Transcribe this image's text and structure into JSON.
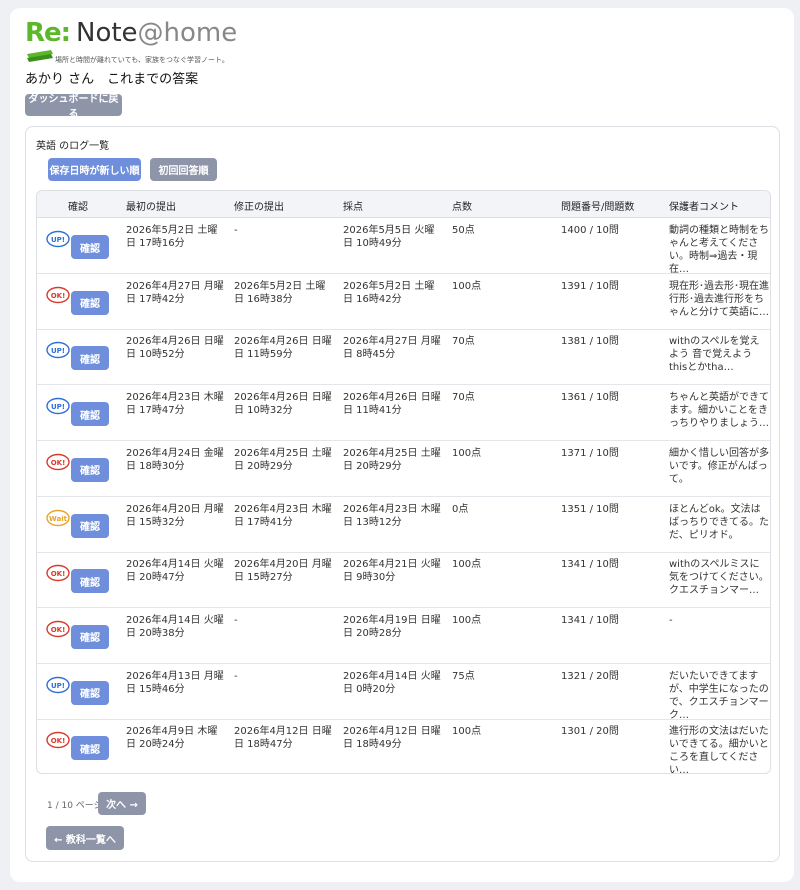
{
  "logo": {
    "re": "Re:",
    "note": "Note",
    "at": "@",
    "home": "home",
    "tagline": "場所と時間が離れていても、家族をつなぐ学習ノート。"
  },
  "page_title": "あかり さん　これまでの答案",
  "back_button": "ダッシュボードに戻る",
  "log_title": "英語 のログ一覧",
  "sort": {
    "newest": "保存日時が新しい順",
    "first": "初回回答順"
  },
  "table": {
    "headers": [
      "確認",
      "最初の提出",
      "修正の提出",
      "採点",
      "点数",
      "問題番号/問題数",
      "保護者コメント"
    ],
    "confirm_label": "確認",
    "rows": [
      {
        "stamp": "up",
        "stamp_text": "UP!",
        "first": "2026年5月2日 土曜日 17時16分",
        "fix": "-",
        "score": "2026年5月5日 火曜日 10時49分",
        "points": "50点",
        "num": "1400 / 10問",
        "comment": "動詞の種類と時制をちゃんと考えてください。時制⇒過去・現在…"
      },
      {
        "stamp": "ok",
        "stamp_text": "OK!",
        "first": "2026年4月27日 月曜日 17時42分",
        "fix": "2026年5月2日 土曜日 16時38分",
        "score": "2026年5月2日 土曜日 16時42分",
        "points": "100点",
        "num": "1391 / 10問",
        "comment": "現在形･過去形･現在進行形･過去進行形をちゃんと分けて英語に…"
      },
      {
        "stamp": "up",
        "stamp_text": "UP!",
        "first": "2026年4月26日 日曜日 10時52分",
        "fix": "2026年4月26日 日曜日 11時59分",
        "score": "2026年4月27日 月曜日 8時45分",
        "points": "70点",
        "num": "1381 / 10問",
        "comment": "withのスペルを覚えよう 音で覚えよう thisとかtha…"
      },
      {
        "stamp": "up",
        "stamp_text": "UP!",
        "first": "2026年4月23日 木曜日 17時47分",
        "fix": "2026年4月26日 日曜日 10時32分",
        "score": "2026年4月26日 日曜日 11時41分",
        "points": "70点",
        "num": "1361 / 10問",
        "comment": "ちゃんと英語ができてます。細かいことをきっちりやりましょう…"
      },
      {
        "stamp": "ok",
        "stamp_text": "OK!",
        "first": "2026年4月24日 金曜日 18時30分",
        "fix": "2026年4月25日 土曜日 20時29分",
        "score": "2026年4月25日 土曜日 20時29分",
        "points": "100点",
        "num": "1371 / 10問",
        "comment": "細かく惜しい回答が多いです。修正がんばって。"
      },
      {
        "stamp": "wait",
        "stamp_text": "Wait",
        "first": "2026年4月20日 月曜日 15時32分",
        "fix": "2026年4月23日 木曜日 17時41分",
        "score": "2026年4月23日 木曜日 13時12分",
        "points": "0点",
        "num": "1351 / 10問",
        "comment": "ほとんどok。文法はばっちりできてる。ただ、ピリオド。"
      },
      {
        "stamp": "ok",
        "stamp_text": "OK!",
        "first": "2026年4月14日 火曜日 20時47分",
        "fix": "2026年4月20日 月曜日 15時27分",
        "score": "2026年4月21日 火曜日 9時30分",
        "points": "100点",
        "num": "1341 / 10問",
        "comment": "withのスペルミスに気をつけてください。クエスチョンマー…"
      },
      {
        "stamp": "ok",
        "stamp_text": "OK!",
        "first": "2026年4月14日 火曜日 20時38分",
        "fix": "-",
        "score": "2026年4月19日 日曜日 20時28分",
        "points": "100点",
        "num": "1341 / 10問",
        "comment": "-"
      },
      {
        "stamp": "up",
        "stamp_text": "UP!",
        "first": "2026年4月13日 月曜日 15時46分",
        "fix": "-",
        "score": "2026年4月14日 火曜日 0時20分",
        "points": "75点",
        "num": "1321 / 20問",
        "comment": "だいたいできてますが、中学生になったので、クエスチョンマーク…"
      },
      {
        "stamp": "ok",
        "stamp_text": "OK!",
        "first": "2026年4月9日 木曜日 20時24分",
        "fix": "2026年4月12日 日曜日 18時47分",
        "score": "2026年4月12日 日曜日 18時49分",
        "points": "100点",
        "num": "1301 / 20問",
        "comment": "進行形の文法はだいたいできてる。細かいところを直してください…"
      }
    ]
  },
  "pager": {
    "text": "1 / 10 ページ",
    "next": "次へ →"
  },
  "subjects_button": "← 教科一覧へ",
  "colors": {
    "brand_green": "#5cb82a",
    "button_blue": "#6f8fdc",
    "button_gray": "#8e95a8",
    "stamp_up": "#2f6fd6",
    "stamp_ok": "#d83a2a",
    "stamp_wait": "#e8a32a"
  }
}
